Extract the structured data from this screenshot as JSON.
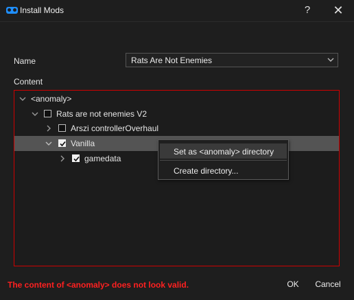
{
  "window": {
    "title": "Install Mods",
    "help_glyph": "?",
    "close_glyph": "✕",
    "accent": "#1f8fff"
  },
  "form": {
    "name_label": "Name",
    "name_value": "Rats Are Not Enemies",
    "content_label": "Content"
  },
  "tree": {
    "border_color": "#d00000",
    "items": [
      {
        "label": "<anomaly>",
        "depth": 0,
        "expanded": true,
        "checkbox": false
      },
      {
        "label": "Rats are not enemies V2",
        "depth": 1,
        "expanded": true,
        "checkbox": true,
        "checked": false
      },
      {
        "label": "Arszi controllerOverhaul",
        "depth": 2,
        "expanded": false,
        "checkbox": true,
        "checked": false
      },
      {
        "label": "Vanilla",
        "depth": 2,
        "expanded": true,
        "checkbox": true,
        "checked": true,
        "selected": true
      },
      {
        "label": "gamedata",
        "depth": 3,
        "expanded": false,
        "checkbox": true,
        "checked": true
      }
    ]
  },
  "context_menu": {
    "items": [
      {
        "label": "Set as <anomaly> directory",
        "highlighted": true
      },
      {
        "label": "Create directory..."
      }
    ]
  },
  "footer": {
    "error": "The content of <anomaly> does not look valid.",
    "error_color": "#ff2020",
    "ok_label": "OK",
    "cancel_label": "Cancel"
  }
}
